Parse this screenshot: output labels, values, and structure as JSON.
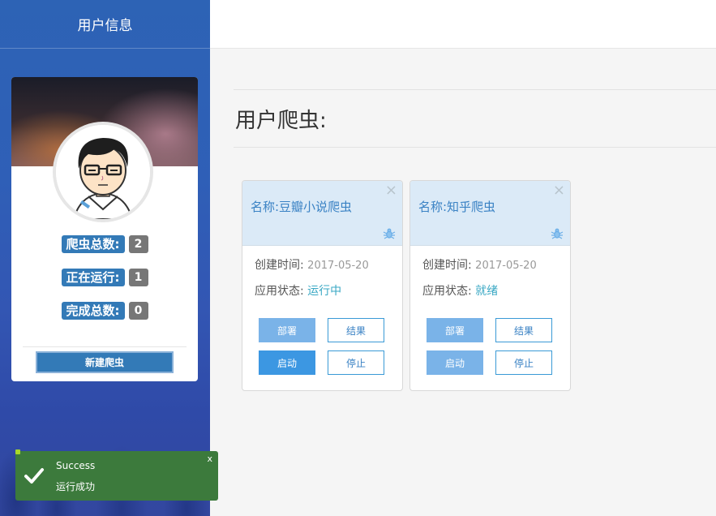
{
  "sidebar": {
    "title": "用户信息",
    "stats": [
      {
        "label": "爬虫总数:",
        "count": "2"
      },
      {
        "label": "正在运行:",
        "count": "1"
      },
      {
        "label": "完成总数:",
        "count": "0"
      }
    ],
    "new_spider_label": "新建爬虫"
  },
  "main": {
    "page_title": "用户爬虫:",
    "cards": [
      {
        "name": "名称:豆瓣小说爬虫",
        "close": "×",
        "created_label": "创建时间:",
        "created_value": "2017-05-20",
        "status_label": "应用状态:",
        "status_value": "运行中",
        "deploy_label": "部署",
        "result_label": "结果",
        "start_label": "启动",
        "stop_label": "停止"
      },
      {
        "name": "名称:知乎爬虫",
        "close": "×",
        "created_label": "创建时间:",
        "created_value": "2017-05-20",
        "status_label": "应用状态:",
        "status_value": "就绪",
        "deploy_label": "部署",
        "result_label": "结果",
        "start_label": "启动",
        "stop_label": "停止"
      }
    ]
  },
  "toast": {
    "title": "Success",
    "message": "运行成功",
    "close": "x"
  },
  "colors": {
    "sidebar_blue": "#2d63b5",
    "primary": "#337ab7",
    "toast_green": "#3c7a3c",
    "card_header": "#dbeaf7"
  },
  "icons": [
    "avatar",
    "close-icon",
    "bug-icon",
    "checkmark-icon"
  ]
}
